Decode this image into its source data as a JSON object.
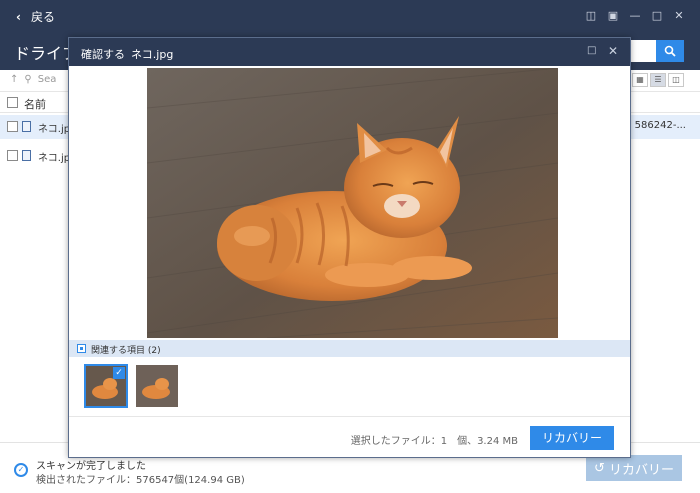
{
  "app": {
    "back_label": "戻る",
    "drive_title": "ドライブ C",
    "search_placeholder": "Sea"
  },
  "file_list": {
    "column_name": "名前",
    "rows": [
      {
        "name": "ネコ.jpg",
        "size": "586242-..."
      },
      {
        "name": "ネコ.jpg",
        "size": ""
      }
    ]
  },
  "status": {
    "line1": "スキャンが完了しました",
    "line2": "検出されたファイル：576547個(124.94 GB)",
    "recover_label": "リカバリー"
  },
  "modal": {
    "title_label": "確認する",
    "file_name": "ネコ.jpg",
    "related_label": "関連する項目 (2)",
    "selection_info": "選択したファイル：1　個、3.24 MB",
    "recover_label": "リカバリー"
  },
  "icons": {
    "back": "chevron-left-icon",
    "search": "search-icon",
    "check": "checkmark-icon",
    "status": "check-circle-icon",
    "recover": "restore-icon"
  },
  "colors": {
    "titlebar": "#2c3a55",
    "accent": "#2f8ae8",
    "selected_row": "#e4eefb",
    "related_bar": "#dce7f5",
    "disabled_button": "#aac6e3"
  }
}
